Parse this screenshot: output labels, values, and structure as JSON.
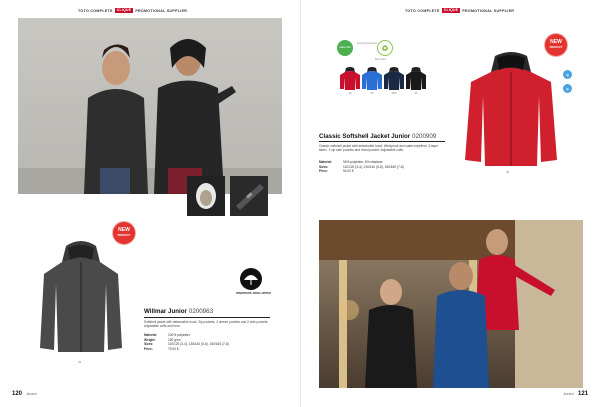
{
  "spread": {
    "left": {
      "header": {
        "a": "TOTO COMPLETE",
        "tag1": "CLIQUE",
        "b": "PROMOTIONAL SUPPLIER"
      },
      "footer": {
        "page": "120",
        "section": "Junior"
      },
      "product": {
        "title": "Willmar Junior",
        "code": "0200963",
        "badge": "NEW",
        "badge_sub": "PRODUCT",
        "description": "Softshell jacket with detachable hood. Zip pockets, 2 sleeve pockets and 2 side pockets. Adjustable cuffs and hem.",
        "specs": [
          {
            "k": "Material:",
            "v": "100% polyester"
          },
          {
            "k": "Weight:",
            "v": "190 g/m²"
          },
          {
            "k": "Sizes:",
            "v": "110/120 (3-4), 130/140 (5-6), 150/160 (7-8)"
          },
          {
            "k": "Price:",
            "v": "79,00 €"
          }
        ],
        "swatch_label": "94",
        "icon_caption": "WINDPROOF WIND LIMITER"
      }
    },
    "right": {
      "header": {
        "a": "TOTO COMPLETE",
        "tag1": "CLIQUE",
        "b": "PROMOTIONAL SUPPLIER"
      },
      "footer": {
        "page": "121",
        "section": "Junior"
      },
      "product": {
        "title": "Classic Softshell Jacket Junior",
        "code": "0200909",
        "badge": "NEW",
        "badge_sub": "PRODUCT",
        "description": "Classic softshell jacket with detachable hood. Windproof and water-repellent. 3-layer fabric. 2 zip side pockets and chest pocket. Adjustable cuffs.",
        "specs": [
          {
            "k": "Material:",
            "v": "94% polyester, 6% elastane"
          },
          {
            "k": "Sizes:",
            "v": "110/120 (3-4), 130/140 (5-6), 150/160 (7-8)"
          },
          {
            "k": "Price:",
            "v": "94,00 €"
          }
        ],
        "cert1": "OEKO-TEX",
        "cert2": "Recycled",
        "cert_caption": "Recycled polyester",
        "swatches": [
          {
            "code": "35",
            "color": "#c8102e"
          },
          {
            "code": "55",
            "color": "#2a6fd6"
          },
          {
            "code": "580",
            "color": "#1a2a44"
          },
          {
            "code": "99",
            "color": "#1a1a1a"
          }
        ],
        "big_label": "35"
      }
    }
  },
  "colors": {
    "accent": "#c8102e",
    "badge": "#e3342f"
  }
}
